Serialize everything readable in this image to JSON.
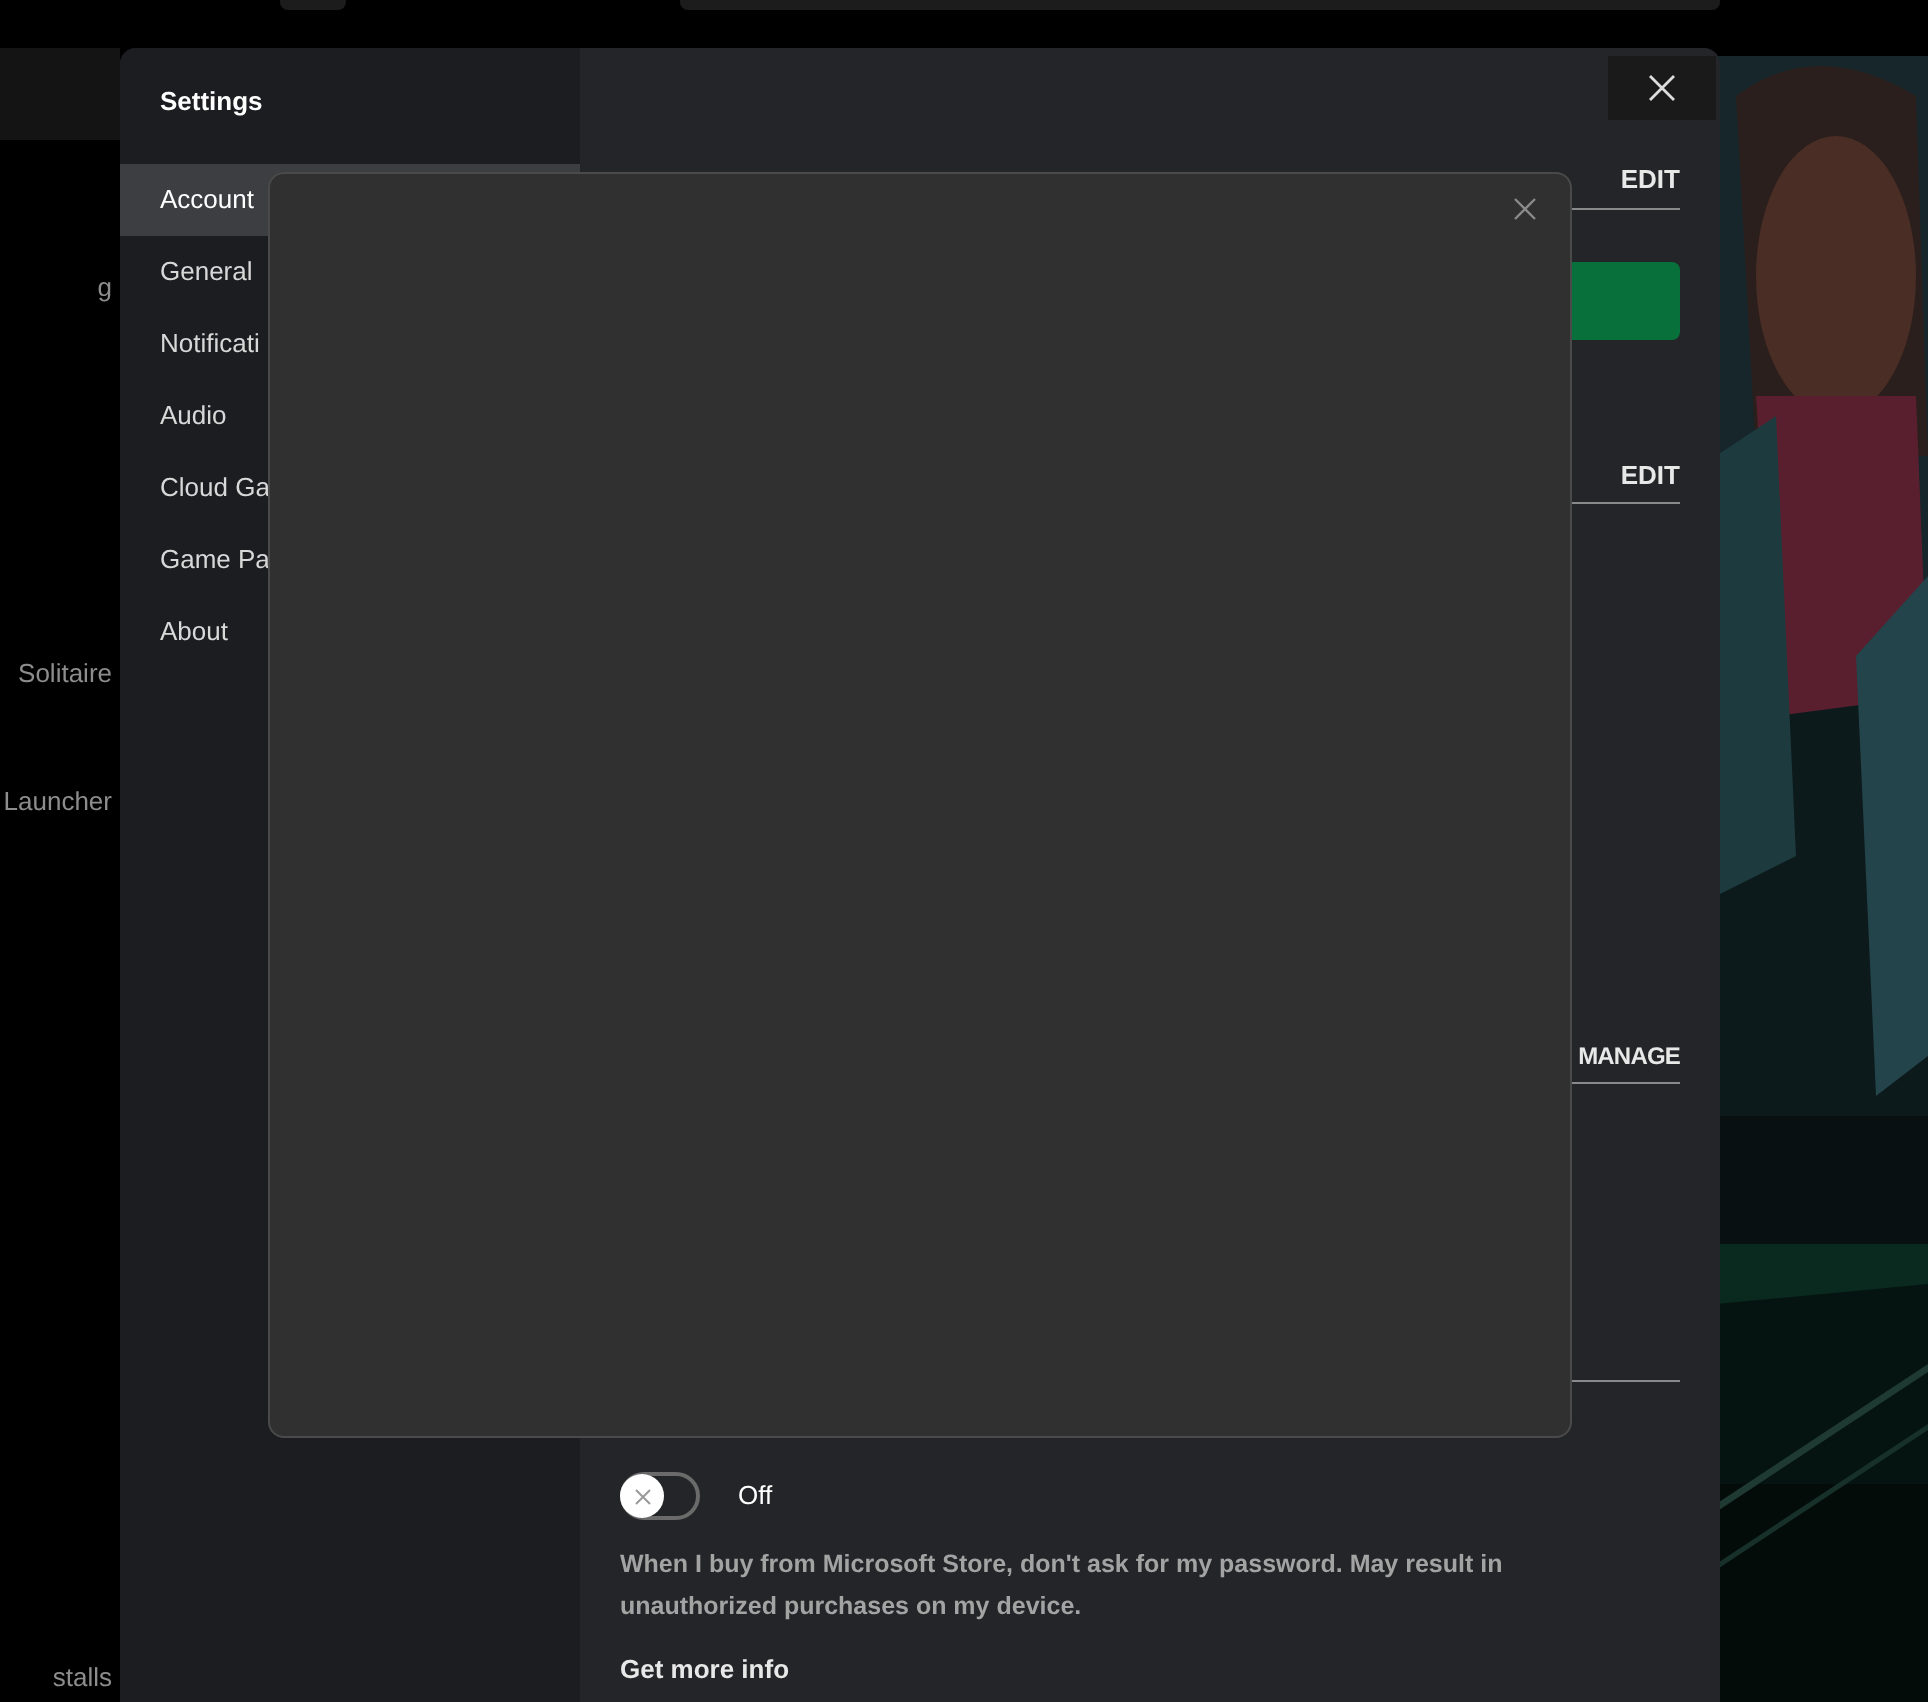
{
  "background_app": {
    "list_items": [
      {
        "label": "g"
      },
      {
        "label": "Solitaire"
      },
      {
        "label": "Launcher"
      },
      {
        "label": "stalls"
      }
    ]
  },
  "settings": {
    "title": "Settings",
    "nav": [
      {
        "label": "Account",
        "selected": true
      },
      {
        "label": "General",
        "selected": false
      },
      {
        "label": "Notificati",
        "selected": false
      },
      {
        "label": "Audio",
        "selected": false
      },
      {
        "label": "Cloud Ga",
        "selected": false
      },
      {
        "label": "Game Pa",
        "selected": false
      },
      {
        "label": "About",
        "selected": false
      }
    ],
    "sections": [
      {
        "kind": "action",
        "action": "EDIT"
      },
      {
        "kind": "button"
      },
      {
        "kind": "action",
        "action": "EDIT"
      },
      {
        "kind": "action",
        "action": "MANAGE"
      },
      {
        "kind": "rule"
      }
    ],
    "purchase_toggle": {
      "on": false,
      "state_label": "Off"
    },
    "description": "When I buy from Microsoft Store, don't ask for my password. May result in unauthorized purchases on my device.",
    "link": "Get more info"
  }
}
